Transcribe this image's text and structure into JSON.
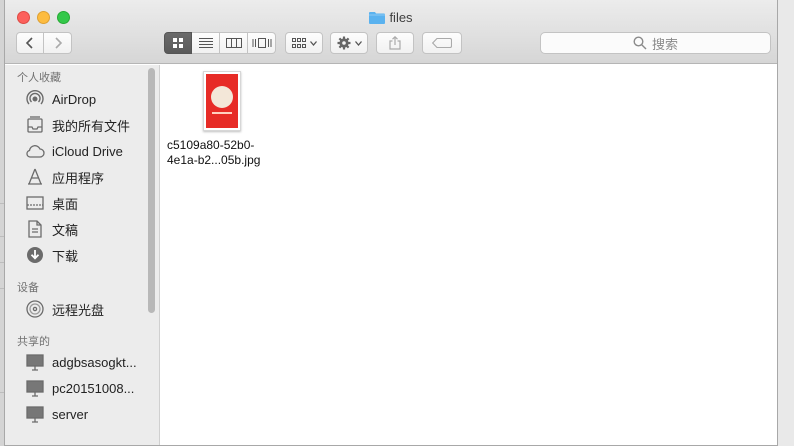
{
  "window": {
    "title": "files"
  },
  "toolbar": {
    "search_placeholder": "搜索",
    "view_modes": [
      "icon-view",
      "list-view",
      "column-view",
      "cover-flow-view"
    ],
    "active_view": "icon-view"
  },
  "sidebar": {
    "favorites_header": "个人收藏",
    "favorites": [
      {
        "label": "AirDrop",
        "icon": "airdrop-icon"
      },
      {
        "label": "我的所有文件",
        "icon": "all-files-icon"
      },
      {
        "label": "iCloud Drive",
        "icon": "cloud-icon"
      },
      {
        "label": "应用程序",
        "icon": "applications-icon"
      },
      {
        "label": "桌面",
        "icon": "desktop-icon"
      },
      {
        "label": "文稿",
        "icon": "document-icon"
      },
      {
        "label": "下载",
        "icon": "download-icon"
      }
    ],
    "devices_header": "设备",
    "devices": [
      {
        "label": "远程光盘",
        "icon": "disc-icon"
      }
    ],
    "shared_header": "共享的",
    "shared": [
      {
        "label": "adgbsasogkt...",
        "icon": "computer-icon"
      },
      {
        "label": "pc20151008...",
        "icon": "computer-icon"
      },
      {
        "label": "server",
        "icon": "computer-icon"
      }
    ]
  },
  "files": [
    {
      "name_line1": "c5109a80-52b0-",
      "name_line2": "4e1a-b2...05b.jpg",
      "thumb_color": "#e72b26"
    }
  ],
  "colors": {
    "accent_folder": "#5ab2ef",
    "close": "#fc605c",
    "minimize": "#fdbc40",
    "maximize": "#34c84a"
  }
}
